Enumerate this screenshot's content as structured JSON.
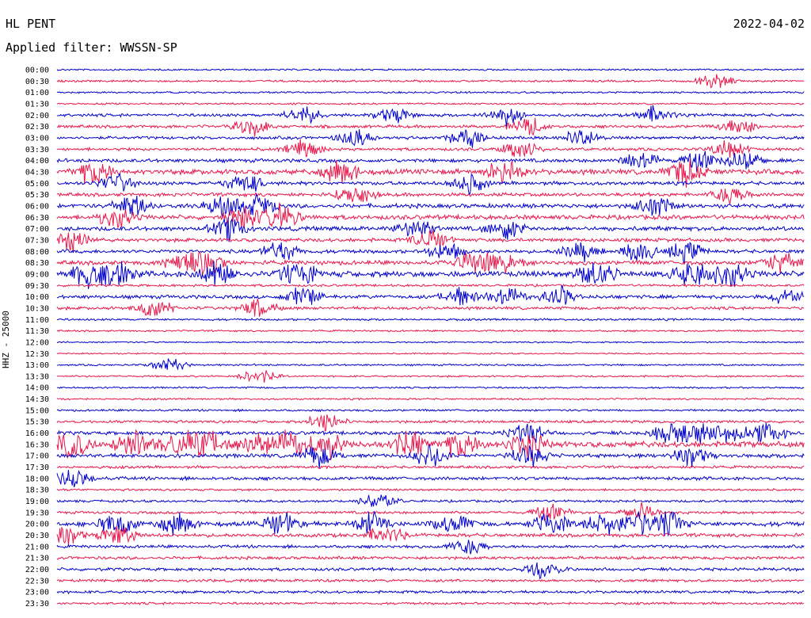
{
  "header": {
    "station": "HL PENT",
    "date": "2022-04-02",
    "filter": "Applied filter: WWSSN-SP"
  },
  "chart_data": {
    "type": "line",
    "title": "HL PENT",
    "ylabel": "HHZ - 25000",
    "colors": [
      "#0000cc",
      "#e8174a"
    ],
    "rows": [
      {
        "label": "00:00",
        "activity": 0.15,
        "bursts": []
      },
      {
        "label": "00:30",
        "activity": 0.2,
        "bursts": [
          0.88
        ]
      },
      {
        "label": "01:00",
        "activity": 0.15,
        "bursts": []
      },
      {
        "label": "01:30",
        "activity": 0.15,
        "bursts": []
      },
      {
        "label": "02:00",
        "activity": 0.35,
        "bursts": [
          0.33,
          0.45,
          0.6,
          0.8
        ]
      },
      {
        "label": "02:30",
        "activity": 0.35,
        "bursts": [
          0.26,
          0.63,
          0.91
        ]
      },
      {
        "label": "03:00",
        "activity": 0.35,
        "bursts": [
          0.4,
          0.55,
          0.7
        ]
      },
      {
        "label": "03:30",
        "activity": 0.35,
        "bursts": [
          0.33,
          0.62,
          0.9
        ]
      },
      {
        "label": "04:00",
        "activity": 0.45,
        "bursts": [
          0.78,
          0.86,
          0.92
        ]
      },
      {
        "label": "04:30",
        "activity": 0.7,
        "bursts": [
          0.05,
          0.38,
          0.6,
          0.84
        ]
      },
      {
        "label": "05:00",
        "activity": 0.45,
        "bursts": [
          0.08,
          0.25,
          0.55
        ]
      },
      {
        "label": "05:30",
        "activity": 0.45,
        "bursts": [
          0.4,
          0.9
        ]
      },
      {
        "label": "06:00",
        "activity": 0.55,
        "bursts": [
          0.1,
          0.22,
          0.27,
          0.8
        ]
      },
      {
        "label": "06:30",
        "activity": 0.6,
        "bursts": [
          0.08,
          0.25,
          0.3
        ]
      },
      {
        "label": "07:00",
        "activity": 0.55,
        "bursts": [
          0.23,
          0.48,
          0.6
        ]
      },
      {
        "label": "07:30",
        "activity": 0.45,
        "bursts": [
          0.02,
          0.5
        ]
      },
      {
        "label": "08:00",
        "activity": 0.45,
        "bursts": [
          0.3,
          0.52,
          0.7,
          0.78,
          0.84
        ]
      },
      {
        "label": "08:30",
        "activity": 0.55,
        "bursts": [
          0.17,
          0.2,
          0.56,
          0.6,
          0.97
        ]
      },
      {
        "label": "09:00",
        "activity": 0.8,
        "bursts": [
          0.04,
          0.08,
          0.21,
          0.32,
          0.72,
          0.85,
          0.9
        ]
      },
      {
        "label": "09:30",
        "activity": 0.25,
        "bursts": []
      },
      {
        "label": "10:00",
        "activity": 0.45,
        "bursts": [
          0.33,
          0.54,
          0.6,
          0.67,
          0.98
        ]
      },
      {
        "label": "10:30",
        "activity": 0.35,
        "bursts": [
          0.13,
          0.27
        ]
      },
      {
        "label": "11:00",
        "activity": 0.2,
        "bursts": []
      },
      {
        "label": "11:30",
        "activity": 0.15,
        "bursts": []
      },
      {
        "label": "12:00",
        "activity": 0.1,
        "bursts": []
      },
      {
        "label": "12:30",
        "activity": 0.1,
        "bursts": []
      },
      {
        "label": "13:00",
        "activity": 0.15,
        "bursts": [
          0.15
        ]
      },
      {
        "label": "13:30",
        "activity": 0.15,
        "bursts": [
          0.27
        ]
      },
      {
        "label": "14:00",
        "activity": 0.15,
        "bursts": []
      },
      {
        "label": "14:30",
        "activity": 0.15,
        "bursts": []
      },
      {
        "label": "15:00",
        "activity": 0.2,
        "bursts": []
      },
      {
        "label": "15:30",
        "activity": 0.3,
        "bursts": [
          0.36
        ]
      },
      {
        "label": "16:00",
        "activity": 0.45,
        "bursts": [
          0.63,
          0.82,
          0.86,
          0.9,
          0.95
        ]
      },
      {
        "label": "16:30",
        "activity": 0.8,
        "bursts": [
          0.02,
          0.1,
          0.16,
          0.2,
          0.26,
          0.31,
          0.36,
          0.47,
          0.54,
          0.63
        ]
      },
      {
        "label": "17:00",
        "activity": 0.5,
        "bursts": [
          0.35,
          0.5,
          0.63,
          0.85
        ]
      },
      {
        "label": "17:30",
        "activity": 0.3,
        "bursts": []
      },
      {
        "label": "18:00",
        "activity": 0.4,
        "bursts": [
          0.02
        ]
      },
      {
        "label": "18:30",
        "activity": 0.2,
        "bursts": []
      },
      {
        "label": "19:00",
        "activity": 0.25,
        "bursts": [
          0.43
        ]
      },
      {
        "label": "19:30",
        "activity": 0.3,
        "bursts": [
          0.66,
          0.78
        ]
      },
      {
        "label": "20:00",
        "activity": 0.6,
        "bursts": [
          0.08,
          0.16,
          0.3,
          0.42,
          0.53,
          0.66,
          0.73,
          0.78,
          0.82
        ]
      },
      {
        "label": "20:30",
        "activity": 0.45,
        "bursts": [
          0.01,
          0.08,
          0.44
        ]
      },
      {
        "label": "21:00",
        "activity": 0.35,
        "bursts": [
          0.55
        ]
      },
      {
        "label": "21:30",
        "activity": 0.35,
        "bursts": []
      },
      {
        "label": "22:00",
        "activity": 0.35,
        "bursts": [
          0.65
        ]
      },
      {
        "label": "22:30",
        "activity": 0.3,
        "bursts": []
      },
      {
        "label": "23:00",
        "activity": 0.3,
        "bursts": []
      },
      {
        "label": "23:30",
        "activity": 0.25,
        "bursts": []
      }
    ]
  }
}
